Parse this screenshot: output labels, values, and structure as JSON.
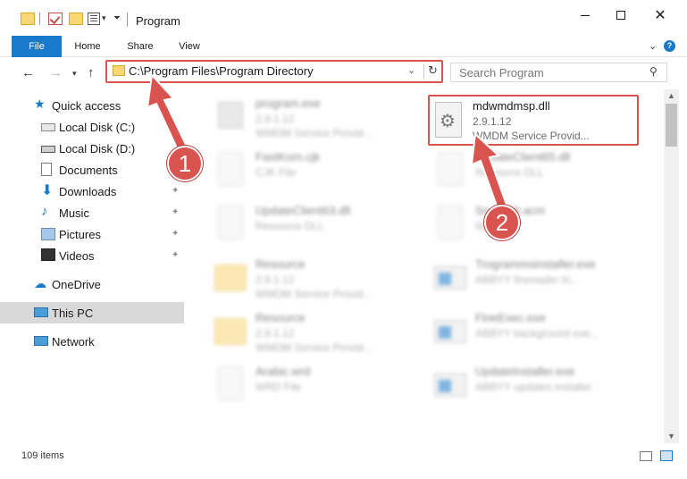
{
  "window": {
    "title": "Program",
    "minimize_label": "—",
    "maximize_label": "☐",
    "close_label": "✕"
  },
  "ribbon": {
    "tabs": [
      "File",
      "Home",
      "Share",
      "View"
    ],
    "chevron": "⌄",
    "help": "?"
  },
  "nav": {
    "back": "←",
    "forward": "→",
    "dropdown": "⌄",
    "up": "↑",
    "address": "C:\\Program Files\\Program Directory",
    "address_dropdown": "⌄",
    "refresh": "↻",
    "search_placeholder": "Search Program",
    "search_glyph": "⚲"
  },
  "sidebar": {
    "items": [
      {
        "label": "Quick access",
        "icon": "star-icon",
        "pinned": false
      },
      {
        "label": "Local Disk (C:)",
        "icon": "disk-icon",
        "pinned": true
      },
      {
        "label": "Local Disk (D:)",
        "icon": "disk-icon",
        "pinned": false
      },
      {
        "label": "Documents",
        "icon": "document-icon",
        "pinned": true
      },
      {
        "label": "Downloads",
        "icon": "download-icon",
        "pinned": true
      },
      {
        "label": "Music",
        "icon": "music-icon",
        "pinned": true
      },
      {
        "label": "Pictures",
        "icon": "pictures-icon",
        "pinned": true
      },
      {
        "label": "Videos",
        "icon": "videos-icon",
        "pinned": true
      },
      {
        "label": "OneDrive",
        "icon": "cloud-icon",
        "pinned": false
      },
      {
        "label": "This PC",
        "icon": "computer-icon",
        "pinned": false,
        "active": true
      },
      {
        "label": "Network",
        "icon": "network-icon",
        "pinned": false
      }
    ],
    "pin_glyph": "📌"
  },
  "files": {
    "left": [
      {
        "name": "program.exe",
        "line2": "2.9.1.12",
        "line3": "WMDM Service Provid...",
        "icon": "program-icon"
      },
      {
        "name": "FastKorn.cjk",
        "line2": "CJK File",
        "line3": "",
        "icon": "document-icon"
      },
      {
        "name": "UpdateClient63.dll",
        "line2": "Resource DLL",
        "line3": "",
        "icon": "document-icon"
      },
      {
        "name": "Resource",
        "line2": "2.9.1.12",
        "line3": "WMDM Service Provid...",
        "icon": "folder-icon"
      },
      {
        "name": "Resource",
        "line2": "2.9.1.12",
        "line3": "WMDM Service Provid...",
        "icon": "folder-icon"
      },
      {
        "name": "Arabic.wrd",
        "line2": "WRD File",
        "line3": "",
        "icon": "document-icon"
      }
    ],
    "right": [
      {
        "name": "mdwmdmsp.dll",
        "line2": "2.9.1.12",
        "line3": "WMDM Service Provid...",
        "icon": "gear-document-icon",
        "highlighted": true
      },
      {
        "name": "UpdateClient65.dll",
        "line2": "Resource DLL",
        "line3": "",
        "icon": "gear-document-icon"
      },
      {
        "name": "Sn...P96.acm",
        "line2": "W...",
        "line3": "",
        "icon": "document-icon"
      },
      {
        "name": "Trogrammsinstaller.exe",
        "line2": "ABBYY fineoader tri...",
        "line3": "",
        "icon": "installer-icon"
      },
      {
        "name": "FineExec.exe",
        "line2": "ABBYY background exe...",
        "line3": "",
        "icon": "installer-icon"
      },
      {
        "name": "UpdateInstaller.exe",
        "line2": "ABBYY updates installer",
        "line3": "",
        "icon": "installer-icon"
      }
    ]
  },
  "status": {
    "items_count": "109 items"
  },
  "annotations": {
    "badge1": "1",
    "badge2": "2",
    "color": "#d9534f"
  },
  "colors": {
    "accent": "#1979ca",
    "annotation_red": "#d9534f",
    "active_nav": "#d9d9d9"
  }
}
